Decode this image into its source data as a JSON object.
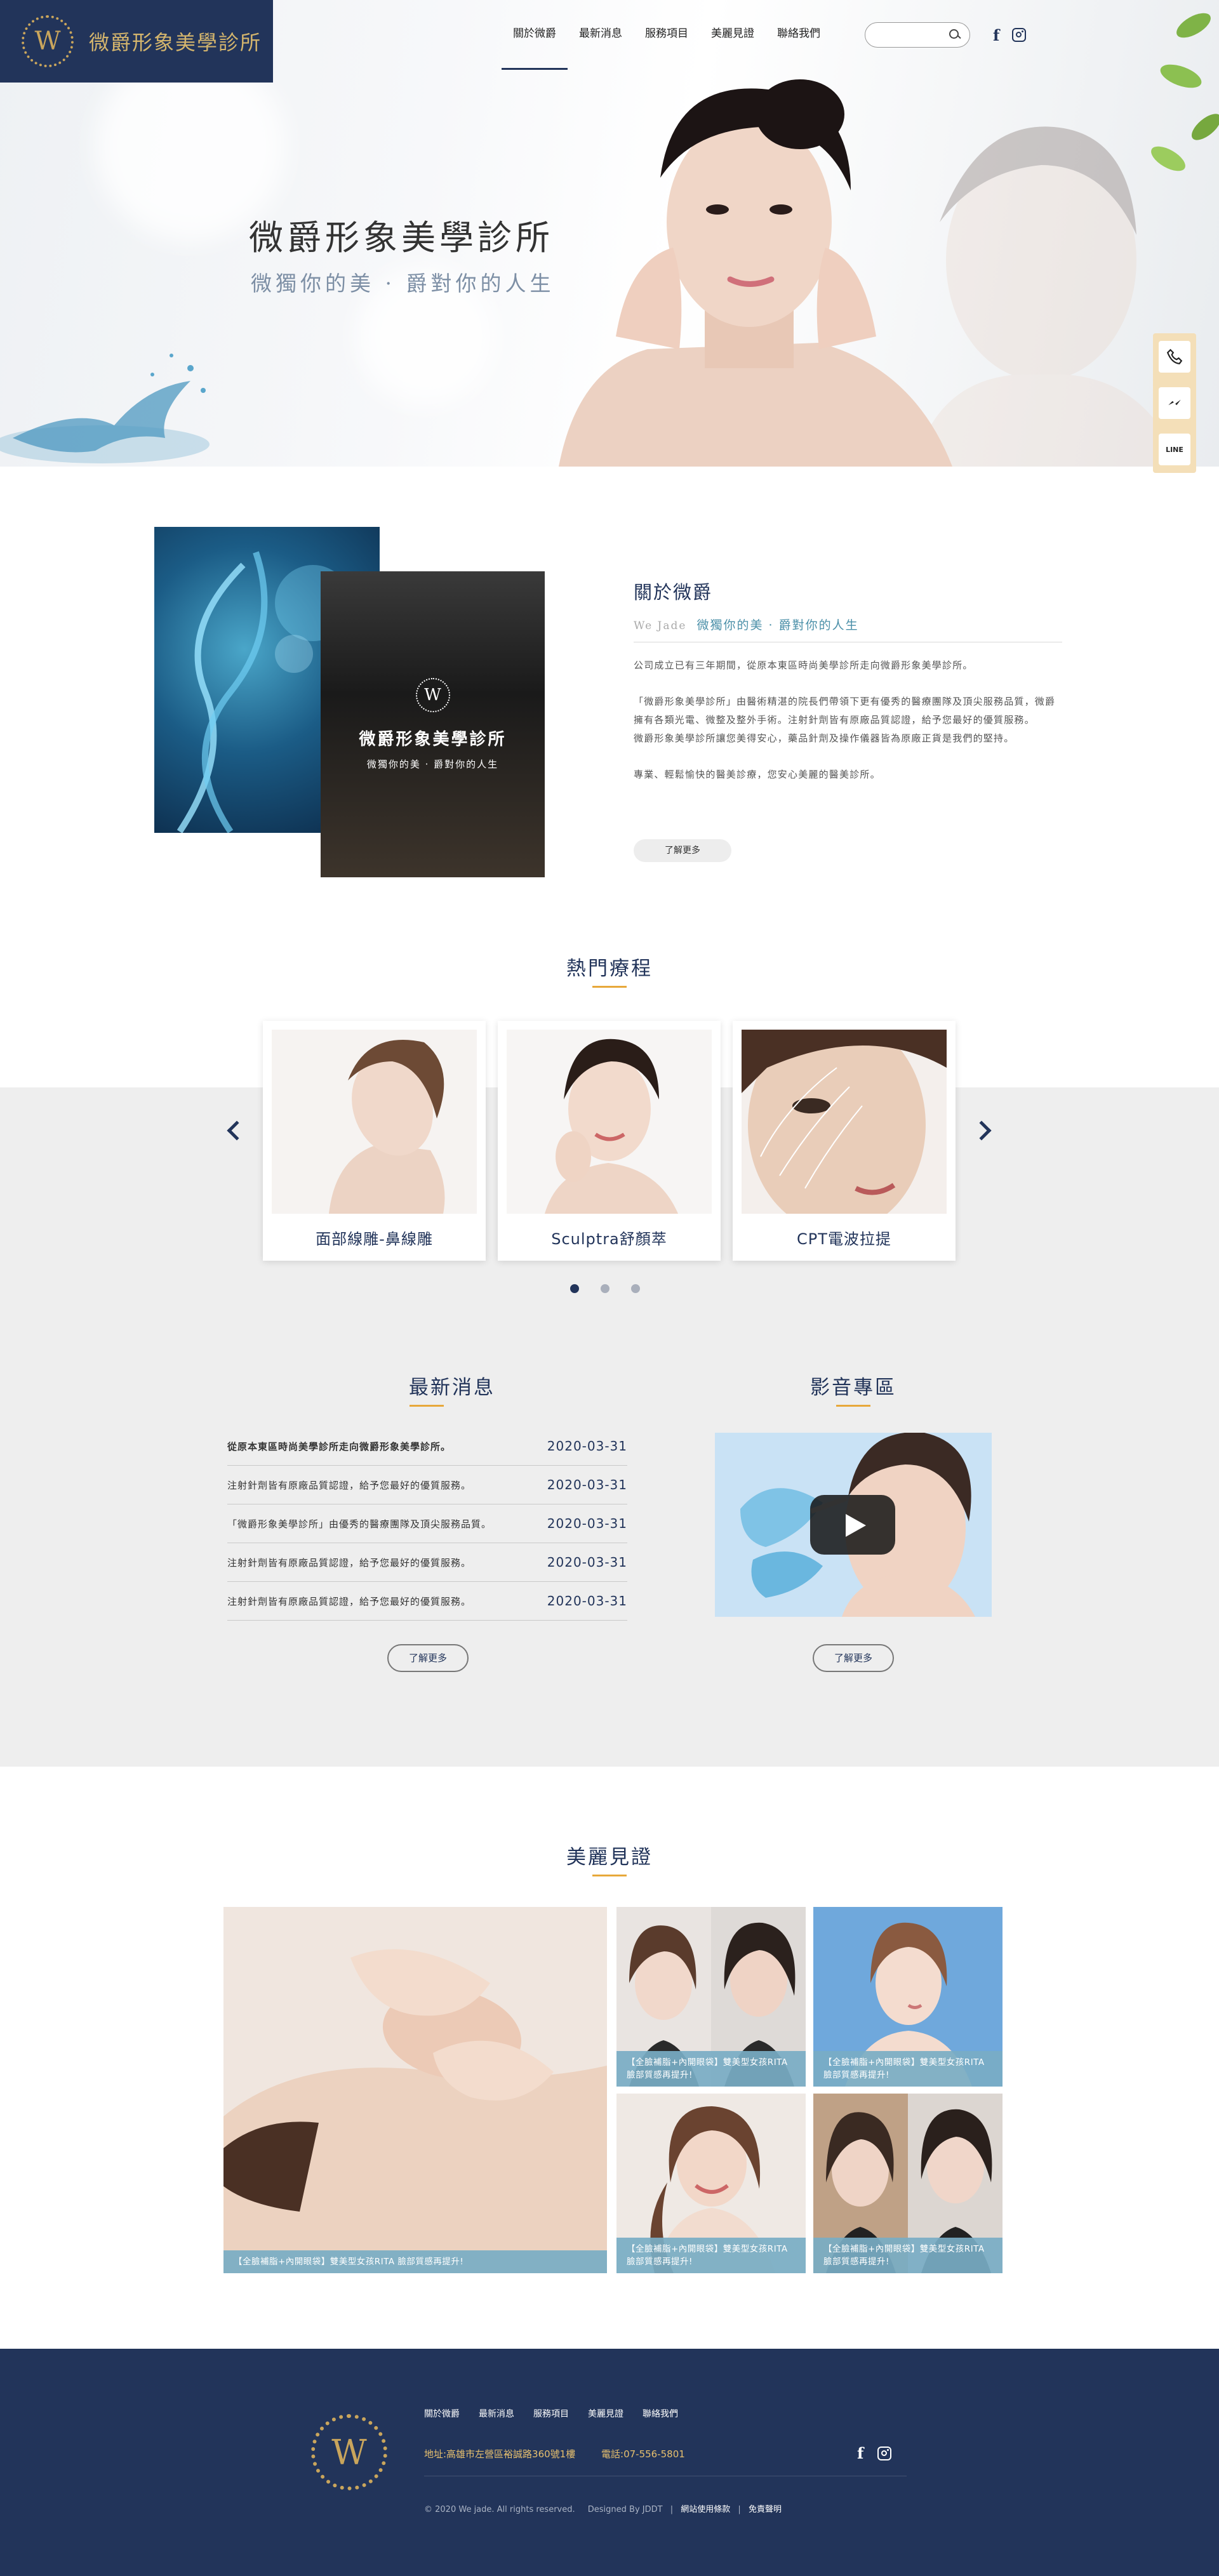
{
  "brand": {
    "name": "微爵形象美學診所",
    "emblem": "W"
  },
  "nav": {
    "items": [
      "關於微爵",
      "最新消息",
      "服務項目",
      "美麗見證",
      "聯絡我們"
    ],
    "active_index": 0
  },
  "search": {
    "placeholder": ""
  },
  "social": {
    "facebook": "f"
  },
  "hero": {
    "title": "微爵形象美學診所",
    "subtitle": "微獨你的美 · 爵對你的人生"
  },
  "side_contact": {
    "line_label": "LINE"
  },
  "about": {
    "image_title": "微爵形象美學診所",
    "image_subtitle": "微獨你的美 · 爵對你的人生",
    "title": "關於微爵",
    "sub_en": "We Jade",
    "sub_zh": "微獨你的美 · 爵對你的人生",
    "p1": "公司成立已有三年期間，從原本東區時尚美學診所走向微爵形象美學診所。",
    "p2a": "「微爵形象美學診所」由醫術精湛的院長們帶領下更有優秀的醫療團隊及頂尖服務品質，微爵擁有各類光電、微整及整外手術。注射針劑皆有原廠品質認證，給予您最好的優質服務。",
    "p2b": "微爵形象美學診所讓您美得安心，藥品針劑及操作儀器皆為原廠正貨是我們的堅持。",
    "p3": "專業、輕鬆愉快的醫美診療，您安心美麗的醫美診所。",
    "more": "了解更多"
  },
  "popular": {
    "title": "熱門療程",
    "items": [
      {
        "label": "面部線雕-鼻線雕"
      },
      {
        "label": "Sculptra舒顏萃"
      },
      {
        "label": "CPT電波拉提"
      }
    ],
    "pages": 3,
    "active_page": 0
  },
  "news": {
    "title": "最新消息",
    "items": [
      {
        "title": "從原本東區時尚美學診所走向微爵形象美學診所。",
        "date": "2020-03-31"
      },
      {
        "title": "注射針劑皆有原廠品質認證，給予您最好的優質服務。",
        "date": "2020-03-31"
      },
      {
        "title": "「微爵形象美學診所」由優秀的醫療團隊及頂尖服務品質。",
        "date": "2020-03-31"
      },
      {
        "title": "注射針劑皆有原廠品質認證，給予您最好的優質服務。",
        "date": "2020-03-31"
      },
      {
        "title": "注射針劑皆有原廠品質認證，給予您最好的優質服務。",
        "date": "2020-03-31"
      }
    ],
    "more": "了解更多"
  },
  "video": {
    "title": "影音專區",
    "more": "了解更多"
  },
  "testimonials": {
    "title": "美麗見證",
    "items": [
      {
        "caption": "【全臉補脂+內開眼袋】雙美型女孩RITA 臉部質感再提升!"
      },
      {
        "caption": "【全臉補脂+內開眼袋】雙美型女孩RITA 臉部質感再提升!"
      },
      {
        "caption": "【全臉補脂+內開眼袋】雙美型女孩RITA 臉部質感再提升!"
      },
      {
        "caption": "【全臉補脂+內開眼袋】雙美型女孩RITA 臉部質感再提升!"
      },
      {
        "caption": "【全臉補脂+內開眼袋】雙美型女孩RITA 臉部質感再提升!"
      }
    ]
  },
  "footer": {
    "nav": [
      "關於微爵",
      "最新消息",
      "服務項目",
      "美麗見證",
      "聯絡我們"
    ],
    "address": "地址:高雄市左營區裕誠路360號1樓",
    "phone": "電話:07-556-5801",
    "copyright": "© 2020 We jade. All rights reserved.",
    "designer": "Designed By JDDT",
    "terms": "網站使用條款",
    "disclaimer": "免責聲明"
  },
  "colors": {
    "navy": "#22345a",
    "gold": "#c9a55c",
    "accent": "#e7a83a",
    "caption": "#78acc4"
  }
}
